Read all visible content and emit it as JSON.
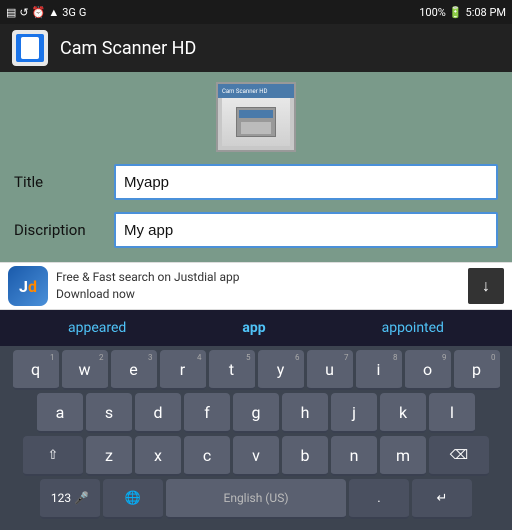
{
  "statusBar": {
    "leftIcons": [
      "notification",
      "rotate",
      "alarm",
      "wifi",
      "3g",
      "g-signal"
    ],
    "battery": "100%",
    "time": "5:08 PM"
  },
  "titleBar": {
    "appName": "Cam Scanner HD"
  },
  "form": {
    "titleLabel": "Title",
    "titleValue": "Myapp",
    "descriptionLabel": "Discription",
    "descriptionValue": "My app"
  },
  "adBanner": {
    "logoText": "Jd",
    "adLine1": "Free & Fast search on Justdial app",
    "adLine2": "Download now",
    "downloadLabel": "↓"
  },
  "keyboard": {
    "suggestions": [
      "appeared",
      "app",
      "appointed"
    ],
    "activeSuggestion": "app",
    "rows": [
      [
        "q",
        "w",
        "e",
        "r",
        "t",
        "y",
        "u",
        "i",
        "o",
        "p"
      ],
      [
        "a",
        "s",
        "d",
        "f",
        "g",
        "h",
        "j",
        "k",
        "l"
      ],
      [
        "⇧",
        "z",
        "x",
        "c",
        "v",
        "b",
        "n",
        "m",
        "⌫"
      ],
      [
        "123",
        "🌐",
        "English (US)",
        ".",
        "↵"
      ]
    ],
    "numbers": [
      "1",
      "2",
      "3",
      "4",
      "5",
      "6",
      "7",
      "8",
      "9",
      "0"
    ],
    "bottomRowLabels": {
      "numKey": "123",
      "mic": "🎤",
      "globe": "🌐",
      "space": "English (US)",
      "period": ".",
      "enter": "↵"
    }
  }
}
